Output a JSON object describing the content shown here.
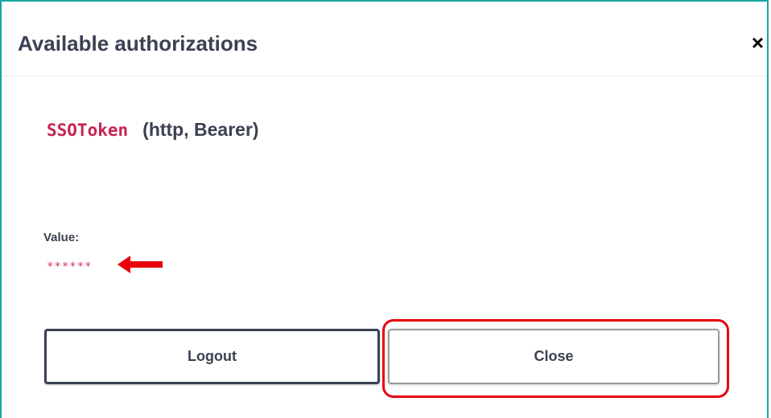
{
  "modal": {
    "title": "Available authorizations",
    "close_icon_glyph": "×"
  },
  "auth": {
    "scheme_name": "SSOToken",
    "scheme_type": "(http, Bearer)",
    "value_label": "Value:",
    "value_masked": "******"
  },
  "buttons": {
    "logout_label": "Logout",
    "close_label": "Close"
  },
  "annotations": {
    "arrow_color": "#e8000b",
    "highlight_color": "#e8000b"
  },
  "colors": {
    "modal_border": "#18a6a6",
    "scheme_name": "#c7254e",
    "text": "#3b4151"
  }
}
